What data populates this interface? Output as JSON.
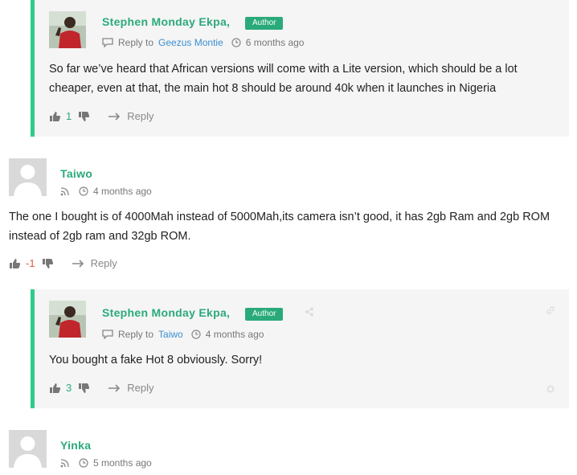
{
  "comments": [
    {
      "author": "Stephen Monday Ekpa,",
      "badge": "Author",
      "reply_to_label": "Reply to",
      "reply_to_name": "Geezus Montie",
      "time": "6 months ago",
      "body": "So far we’ve heard that African versions will come with a Lite version, which should be a lot cheaper, even at that, the main hot 8 should be around 40k when it launches in Nigeria",
      "votes": "1",
      "reply_label": "Reply"
    },
    {
      "author": "Taiwo",
      "time": "4 months ago",
      "body": "The one I bought is of 4000Mah instead of 5000Mah,its camera isn’t good, it has 2gb Ram and 2gb ROM instead of 2gb ram and 32gb ROM.",
      "votes": "-1",
      "reply_label": "Reply"
    },
    {
      "author": "Stephen Monday Ekpa,",
      "badge": "Author",
      "reply_to_label": "Reply to",
      "reply_to_name": "Taiwo",
      "time": "4 months ago",
      "body": "You bought a fake Hot 8 obviously. Sorry!",
      "votes": "3",
      "reply_label": "Reply"
    },
    {
      "author": "Yinka",
      "time": "5 months ago"
    }
  ],
  "colors": {
    "accent": "#2aaa7a",
    "link": "#3b8fd1",
    "negative": "#e05a3a",
    "reply_bg": "#f5f5f5"
  }
}
